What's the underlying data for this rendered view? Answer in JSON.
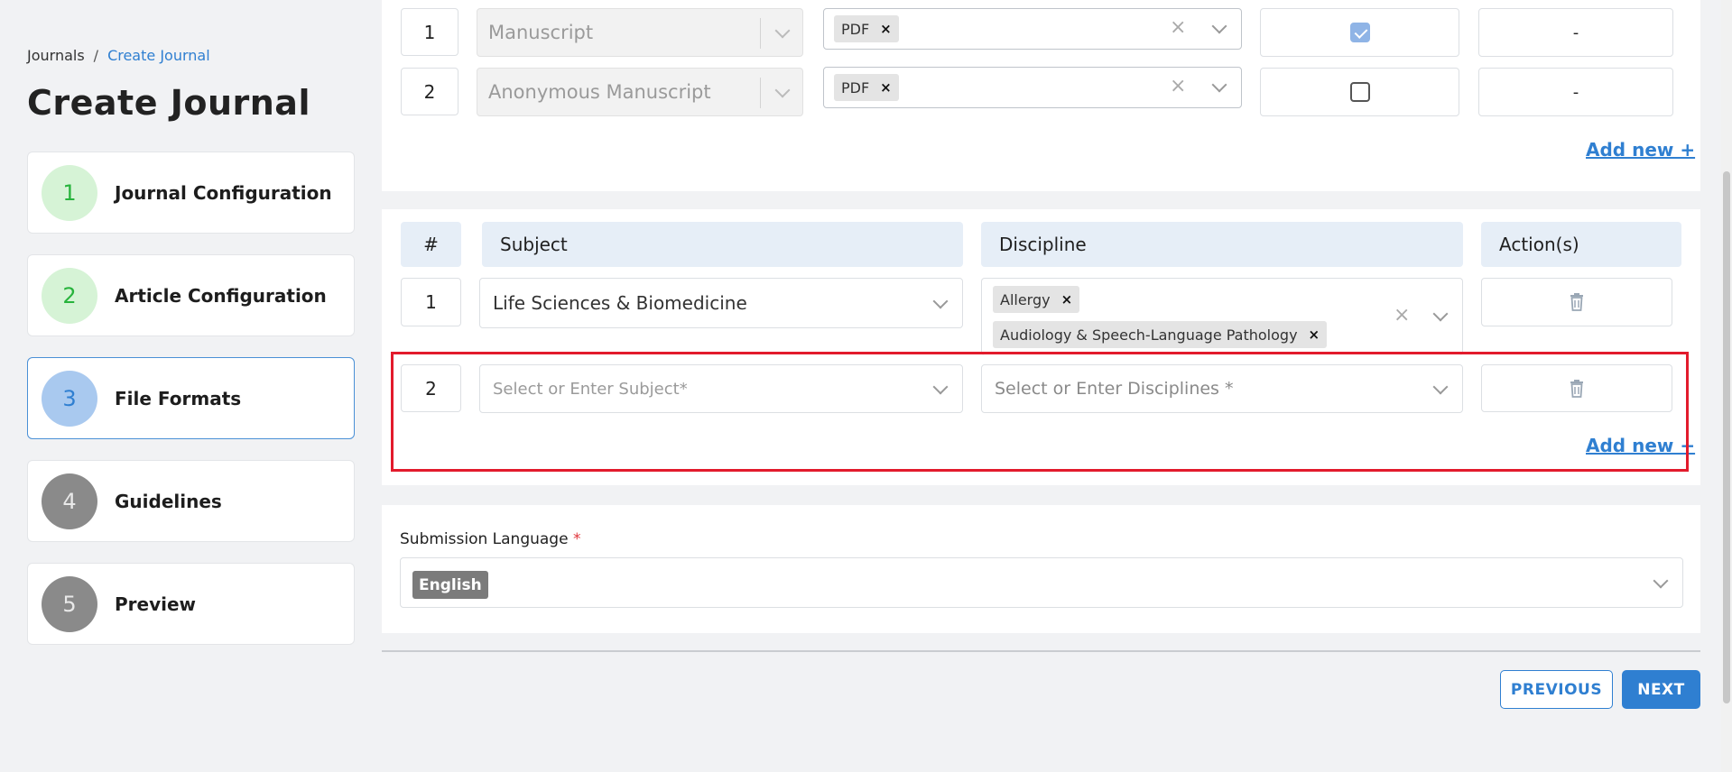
{
  "breadcrumb": {
    "root": "Journals",
    "separator": "/",
    "current": "Create Journal"
  },
  "page_title": "Create Journal",
  "steps": [
    {
      "number": "1",
      "label": "Journal Configuration",
      "state": "done"
    },
    {
      "number": "2",
      "label": "Article Configuration",
      "state": "done"
    },
    {
      "number": "3",
      "label": "File Formats",
      "state": "current"
    },
    {
      "number": "4",
      "label": "Guidelines",
      "state": "todo"
    },
    {
      "number": "5",
      "label": "Preview",
      "state": "todo"
    }
  ],
  "file_formats": {
    "rows": [
      {
        "number": "1",
        "type": "Manuscript",
        "formats": [
          "PDF"
        ],
        "checked": true,
        "action": "-"
      },
      {
        "number": "2",
        "type": "Anonymous Manuscript",
        "formats": [
          "PDF"
        ],
        "checked": false,
        "action": "-"
      }
    ],
    "add_new": "Add new +"
  },
  "subjects": {
    "headers": {
      "number": "#",
      "subject": "Subject",
      "discipline": "Discipline",
      "actions": "Action(s)"
    },
    "rows": [
      {
        "number": "1",
        "subject": "Life Sciences & Biomedicine",
        "disciplines": [
          "Allergy",
          "Audiology & Speech-Language Pathology"
        ]
      },
      {
        "number": "2",
        "subject_placeholder": "Select or Enter Subject*",
        "discipline_placeholder": "Select or Enter Disciplines *"
      }
    ],
    "add_new": "Add new +"
  },
  "submission_language": {
    "label": "Submission Language",
    "required_mark": "*",
    "selected": "English"
  },
  "buttons": {
    "previous": "PREVIOUS",
    "next": "NEXT"
  },
  "colors": {
    "accent": "#2f7fd1",
    "highlight": "#e21b2c",
    "done": "#27b33c"
  }
}
